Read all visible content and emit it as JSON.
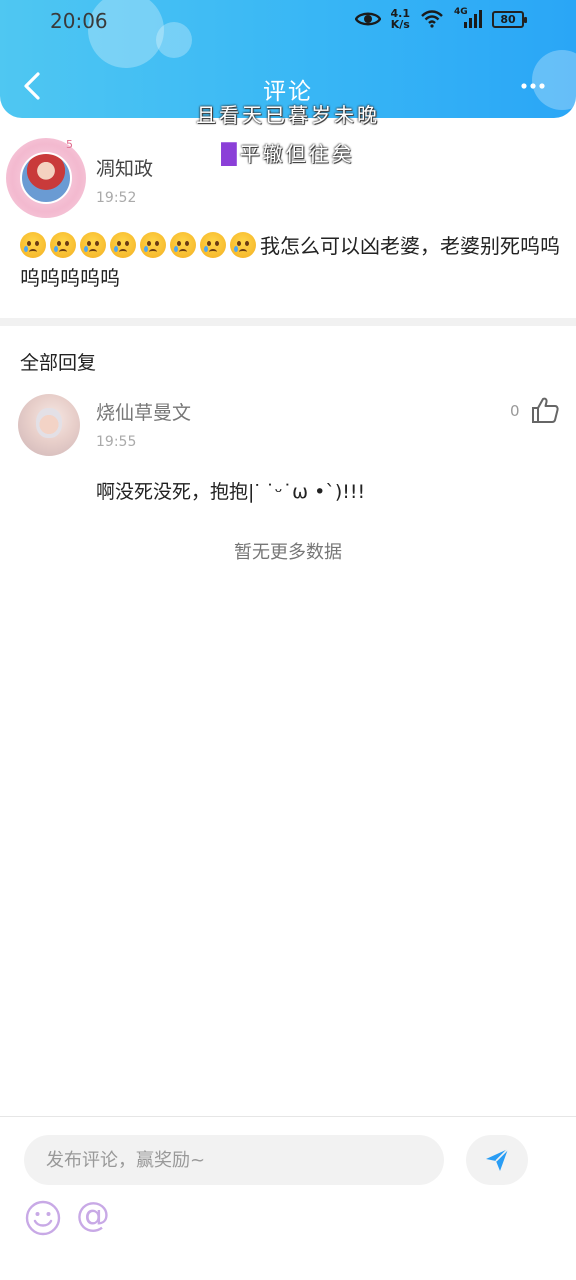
{
  "status_bar": {
    "time": "20:06",
    "network_speed_value": "4.1",
    "network_speed_unit": "K/s",
    "network_type": "4G",
    "battery": "80"
  },
  "header": {
    "title": "评论",
    "overlay_line1": "且看天已暮岁未晚",
    "overlay_line2_mark": "█",
    "overlay_line2": "平辙但往矣"
  },
  "post": {
    "author": "凋知政",
    "level": "5",
    "time": "19:52",
    "emoji_count": 8,
    "text": "我怎么可以凶老婆，老婆别死呜呜呜呜呜呜呜"
  },
  "replies_section": {
    "title": "全部回复"
  },
  "reply": {
    "author": "烧仙草曼文",
    "time": "19:55",
    "like_count": "0",
    "text": "啊没死没死，抱抱|ᐝ ˙ᵕ˙ω •`)!!!"
  },
  "list_end_text": "暂无更多数据",
  "comment_box": {
    "placeholder": "发布评论，赢奖励~",
    "at_symbol": "@"
  },
  "colors": {
    "header_gradient_start": "#4fc7f2",
    "header_gradient_end": "#2aa6f6",
    "send_icon": "#2a9df4",
    "tool_icons": "#c8a9e6"
  }
}
